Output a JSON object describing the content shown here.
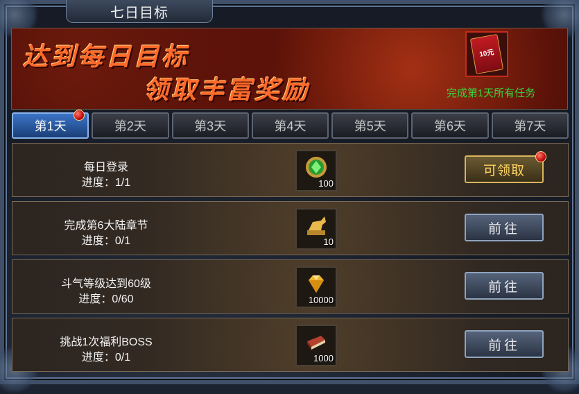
{
  "window": {
    "title": "七日目标"
  },
  "banner": {
    "line1": "达到每日目标",
    "line2": "领取丰富奖励",
    "reward_icon_text": "10元",
    "reward_caption": "完成第1天所有任务"
  },
  "tabs": [
    {
      "label": "第1天",
      "active": true,
      "has_dot": true
    },
    {
      "label": "第2天",
      "active": false
    },
    {
      "label": "第3天",
      "active": false
    },
    {
      "label": "第4天",
      "active": false
    },
    {
      "label": "第5天",
      "active": false
    },
    {
      "label": "第6天",
      "active": false
    },
    {
      "label": "第7天",
      "active": false
    }
  ],
  "tasks": [
    {
      "name": "每日登录",
      "progress": "进度：1/1",
      "item_icon": "green-gem-icon",
      "item_qty": "100",
      "action": "可领取",
      "action_type": "claim",
      "has_dot": true
    },
    {
      "name": "完成第6大陆章节",
      "progress": "进度：0/1",
      "item_icon": "golden-horse-statue-icon",
      "item_qty": "10",
      "action": "前往",
      "action_type": "goto"
    },
    {
      "name": "斗气等级达到60级",
      "progress": "进度：0/60",
      "item_icon": "gold-diamond-icon",
      "item_qty": "10000",
      "action": "前往",
      "action_type": "goto"
    },
    {
      "name": "挑战1次福利BOSS",
      "progress": "进度：0/1",
      "item_icon": "red-book-icon",
      "item_qty": "1000",
      "action": "前往",
      "action_type": "goto"
    }
  ],
  "colors": {
    "active_tab": "#3c74c7",
    "caption_green": "#37d43f",
    "banner_text": "#ff6a2a",
    "claim_text": "#ffd561"
  }
}
